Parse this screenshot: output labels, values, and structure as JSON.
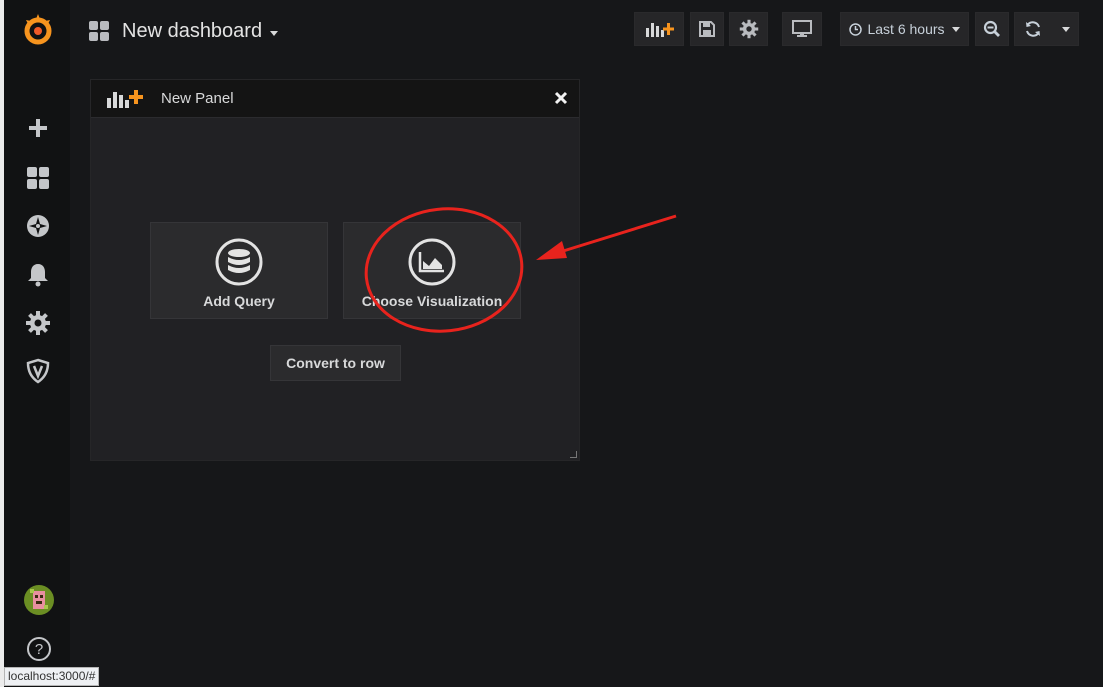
{
  "dashboard": {
    "title": "New dashboard"
  },
  "toolbar": {
    "time_range": "Last 6 hours"
  },
  "panel": {
    "title": "New Panel",
    "actions": [
      {
        "label": "Add Query",
        "icon": "database-icon"
      },
      {
        "label": "Choose Visualization",
        "icon": "area-chart-icon"
      }
    ],
    "convert_label": "Convert to row"
  },
  "sidemenu": {
    "icons": [
      "grafana-logo",
      "plus-icon",
      "dashboards-icon",
      "compass-icon",
      "bell-icon",
      "gear-icon",
      "shield-icon",
      "avatar",
      "help-icon"
    ]
  },
  "statusbar": {
    "url": "localhost:3000/#"
  },
  "annotation": {
    "color": "#e8231d"
  },
  "colors": {
    "accent": "#f7941e",
    "background": "#161719",
    "panel": "#212124"
  }
}
